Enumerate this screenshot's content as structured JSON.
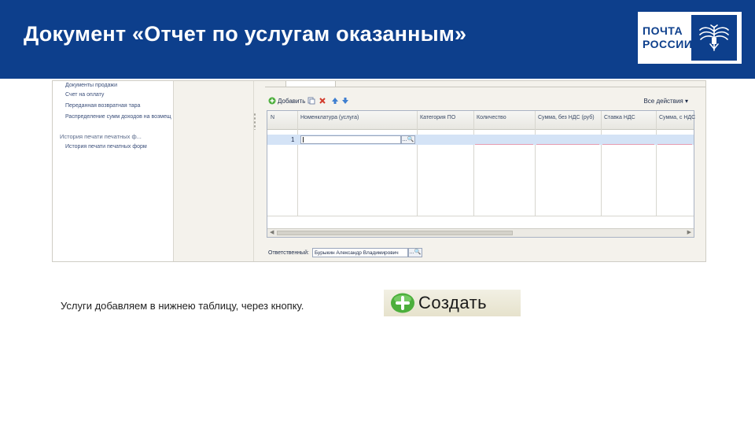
{
  "header": {
    "title": "Документ «Отчет по услугам оказанным»",
    "logo_line1": "ПОЧТА",
    "logo_line2": "РОССИИ",
    "bg_color": "#0d3f8c"
  },
  "left_panel": {
    "items": [
      "Документы продажи",
      "Счет на оплату",
      "Переданная возвратная тара",
      "Распределение сумм доходов на возмещ"
    ],
    "group_title": "История печати печатных ф...",
    "group_items": [
      "История печати печатных форм"
    ]
  },
  "toolbar": {
    "add_label": "Добавить",
    "all_actions_label": "Все действия ▾",
    "icons": [
      "add-icon",
      "copy-icon",
      "delete-icon",
      "move-up-icon",
      "move-down-icon"
    ]
  },
  "grid": {
    "columns": [
      "N",
      "Номенклатура (услуга)",
      "Категория ПО",
      "Количество",
      "Сумма, без НДС (руб)",
      "Ставка НДС",
      "Сумма, с НДС"
    ],
    "rows": [
      {
        "n": "1",
        "nomenclature": "",
        "select_button": "...🔍"
      }
    ]
  },
  "responsible": {
    "label": "Ответственный:",
    "value": "Бурыкин Александр Владимирович",
    "select_button": "...🔍"
  },
  "caption": "Услуги добавляем в нижнею таблицу, через кнопку.",
  "create_button": {
    "label": "Создать",
    "icon": "plus-circle-icon",
    "icon_color": "#4caf3c"
  }
}
